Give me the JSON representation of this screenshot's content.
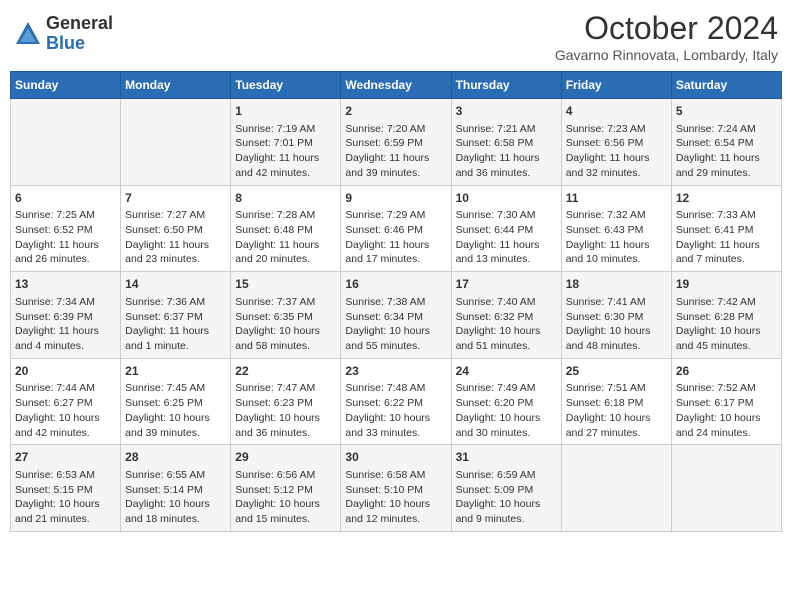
{
  "header": {
    "logo_line1": "General",
    "logo_line2": "Blue",
    "month": "October 2024",
    "location": "Gavarno Rinnovata, Lombardy, Italy"
  },
  "days_of_week": [
    "Sunday",
    "Monday",
    "Tuesday",
    "Wednesday",
    "Thursday",
    "Friday",
    "Saturday"
  ],
  "weeks": [
    [
      {
        "day": "",
        "content": ""
      },
      {
        "day": "",
        "content": ""
      },
      {
        "day": "1",
        "content": "Sunrise: 7:19 AM\nSunset: 7:01 PM\nDaylight: 11 hours and 42 minutes."
      },
      {
        "day": "2",
        "content": "Sunrise: 7:20 AM\nSunset: 6:59 PM\nDaylight: 11 hours and 39 minutes."
      },
      {
        "day": "3",
        "content": "Sunrise: 7:21 AM\nSunset: 6:58 PM\nDaylight: 11 hours and 36 minutes."
      },
      {
        "day": "4",
        "content": "Sunrise: 7:23 AM\nSunset: 6:56 PM\nDaylight: 11 hours and 32 minutes."
      },
      {
        "day": "5",
        "content": "Sunrise: 7:24 AM\nSunset: 6:54 PM\nDaylight: 11 hours and 29 minutes."
      }
    ],
    [
      {
        "day": "6",
        "content": "Sunrise: 7:25 AM\nSunset: 6:52 PM\nDaylight: 11 hours and 26 minutes."
      },
      {
        "day": "7",
        "content": "Sunrise: 7:27 AM\nSunset: 6:50 PM\nDaylight: 11 hours and 23 minutes."
      },
      {
        "day": "8",
        "content": "Sunrise: 7:28 AM\nSunset: 6:48 PM\nDaylight: 11 hours and 20 minutes."
      },
      {
        "day": "9",
        "content": "Sunrise: 7:29 AM\nSunset: 6:46 PM\nDaylight: 11 hours and 17 minutes."
      },
      {
        "day": "10",
        "content": "Sunrise: 7:30 AM\nSunset: 6:44 PM\nDaylight: 11 hours and 13 minutes."
      },
      {
        "day": "11",
        "content": "Sunrise: 7:32 AM\nSunset: 6:43 PM\nDaylight: 11 hours and 10 minutes."
      },
      {
        "day": "12",
        "content": "Sunrise: 7:33 AM\nSunset: 6:41 PM\nDaylight: 11 hours and 7 minutes."
      }
    ],
    [
      {
        "day": "13",
        "content": "Sunrise: 7:34 AM\nSunset: 6:39 PM\nDaylight: 11 hours and 4 minutes."
      },
      {
        "day": "14",
        "content": "Sunrise: 7:36 AM\nSunset: 6:37 PM\nDaylight: 11 hours and 1 minute."
      },
      {
        "day": "15",
        "content": "Sunrise: 7:37 AM\nSunset: 6:35 PM\nDaylight: 10 hours and 58 minutes."
      },
      {
        "day": "16",
        "content": "Sunrise: 7:38 AM\nSunset: 6:34 PM\nDaylight: 10 hours and 55 minutes."
      },
      {
        "day": "17",
        "content": "Sunrise: 7:40 AM\nSunset: 6:32 PM\nDaylight: 10 hours and 51 minutes."
      },
      {
        "day": "18",
        "content": "Sunrise: 7:41 AM\nSunset: 6:30 PM\nDaylight: 10 hours and 48 minutes."
      },
      {
        "day": "19",
        "content": "Sunrise: 7:42 AM\nSunset: 6:28 PM\nDaylight: 10 hours and 45 minutes."
      }
    ],
    [
      {
        "day": "20",
        "content": "Sunrise: 7:44 AM\nSunset: 6:27 PM\nDaylight: 10 hours and 42 minutes."
      },
      {
        "day": "21",
        "content": "Sunrise: 7:45 AM\nSunset: 6:25 PM\nDaylight: 10 hours and 39 minutes."
      },
      {
        "day": "22",
        "content": "Sunrise: 7:47 AM\nSunset: 6:23 PM\nDaylight: 10 hours and 36 minutes."
      },
      {
        "day": "23",
        "content": "Sunrise: 7:48 AM\nSunset: 6:22 PM\nDaylight: 10 hours and 33 minutes."
      },
      {
        "day": "24",
        "content": "Sunrise: 7:49 AM\nSunset: 6:20 PM\nDaylight: 10 hours and 30 minutes."
      },
      {
        "day": "25",
        "content": "Sunrise: 7:51 AM\nSunset: 6:18 PM\nDaylight: 10 hours and 27 minutes."
      },
      {
        "day": "26",
        "content": "Sunrise: 7:52 AM\nSunset: 6:17 PM\nDaylight: 10 hours and 24 minutes."
      }
    ],
    [
      {
        "day": "27",
        "content": "Sunrise: 6:53 AM\nSunset: 5:15 PM\nDaylight: 10 hours and 21 minutes."
      },
      {
        "day": "28",
        "content": "Sunrise: 6:55 AM\nSunset: 5:14 PM\nDaylight: 10 hours and 18 minutes."
      },
      {
        "day": "29",
        "content": "Sunrise: 6:56 AM\nSunset: 5:12 PM\nDaylight: 10 hours and 15 minutes."
      },
      {
        "day": "30",
        "content": "Sunrise: 6:58 AM\nSunset: 5:10 PM\nDaylight: 10 hours and 12 minutes."
      },
      {
        "day": "31",
        "content": "Sunrise: 6:59 AM\nSunset: 5:09 PM\nDaylight: 10 hours and 9 minutes."
      },
      {
        "day": "",
        "content": ""
      },
      {
        "day": "",
        "content": ""
      }
    ]
  ]
}
